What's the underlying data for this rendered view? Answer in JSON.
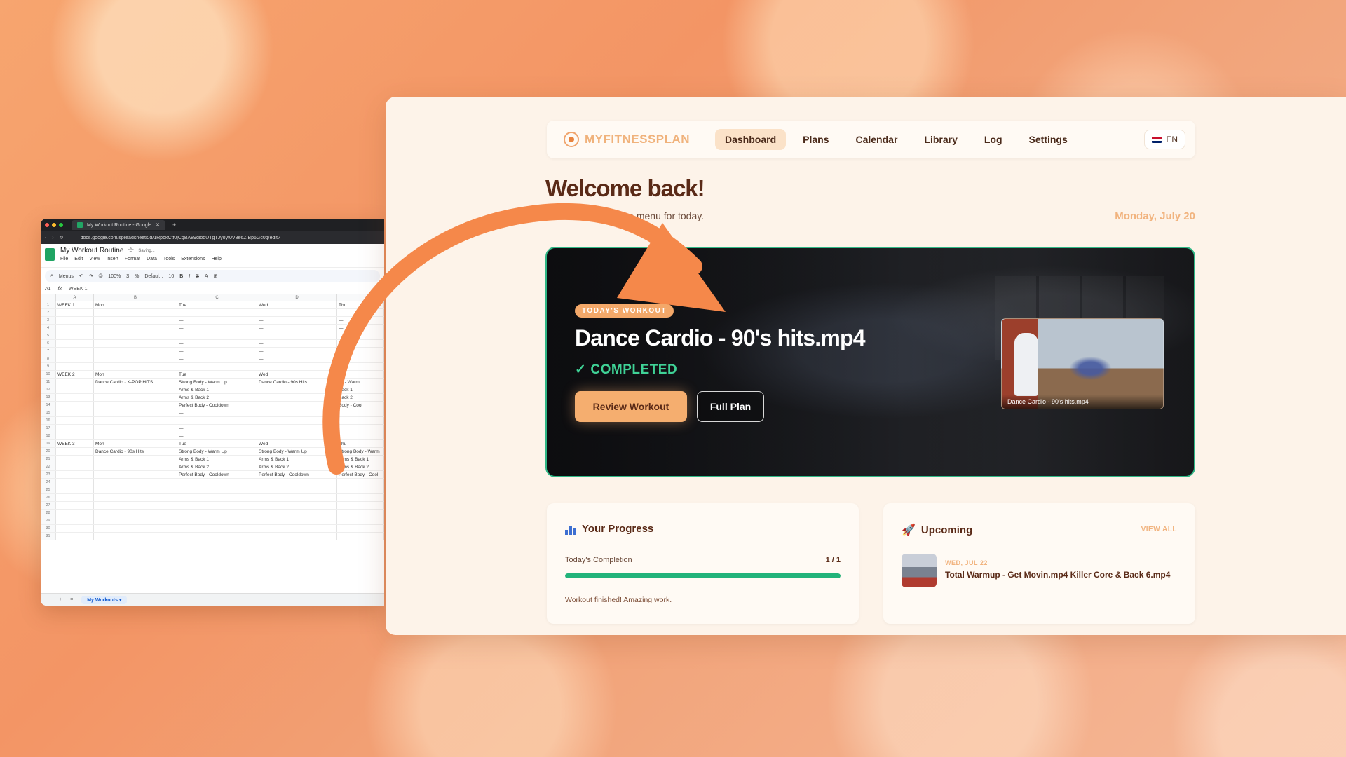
{
  "colors": {
    "accent": "#f5ae6f",
    "completed": "#3fd296",
    "progress_fill": "#22b37a",
    "hero_border": "#2fb685",
    "arrow": "#f5884a"
  },
  "sheet": {
    "browser_tab": "My Workout Routine - Google",
    "url": "docs.google.com/spreadsheets/d/1RpbkCtf0jCgBA89dlodUTgTJyoyt0V8e6ZIBp6Gc0g/edit?",
    "title": "My Workout Routine",
    "saving": "Saving...",
    "menu": [
      "File",
      "Edit",
      "View",
      "Insert",
      "Format",
      "Data",
      "Tools",
      "Extensions",
      "Help"
    ],
    "toolbar": {
      "menus": "Menus",
      "zoom": "100%",
      "currency": "$",
      "percent": "%",
      "font": "Defaul...",
      "font_size": "10"
    },
    "cell_ref": "A1",
    "formula": "WEEK 1",
    "columns": [
      "A",
      "B",
      "C",
      "D",
      ""
    ],
    "rows": [
      [
        "1",
        "WEEK 1",
        "Mon",
        "Tue",
        "Wed",
        "Thu"
      ],
      [
        "2",
        "",
        "—",
        "—",
        "—",
        "—"
      ],
      [
        "3",
        "",
        "",
        "—",
        "—",
        "—"
      ],
      [
        "4",
        "",
        "",
        "—",
        "—",
        "—"
      ],
      [
        "5",
        "",
        "",
        "—",
        "—",
        "—"
      ],
      [
        "6",
        "",
        "",
        "—",
        "—",
        "—"
      ],
      [
        "7",
        "",
        "",
        "—",
        "—",
        ""
      ],
      [
        "8",
        "",
        "",
        "—",
        "—",
        ""
      ],
      [
        "9",
        "",
        "",
        "—",
        "—",
        ""
      ],
      [
        "10",
        "WEEK 2",
        "Mon",
        "Tue",
        "Wed",
        ""
      ],
      [
        "11",
        "",
        "Dance Cardio - K-POP HITS",
        "Strong Body - Warm Up",
        "Dance Cardio - 90s Hits",
        "dy - Warm"
      ],
      [
        "12",
        "",
        "",
        "Arms & Back 1",
        "",
        "Back 1"
      ],
      [
        "13",
        "",
        "",
        "Arms & Back 2",
        "",
        "Back 2"
      ],
      [
        "14",
        "",
        "",
        "Perfect Body - Cooldown",
        "",
        "Body - Cool"
      ],
      [
        "15",
        "",
        "",
        "—",
        "",
        ""
      ],
      [
        "16",
        "",
        "",
        "—",
        "",
        ""
      ],
      [
        "17",
        "",
        "",
        "—",
        "",
        ""
      ],
      [
        "18",
        "",
        "",
        "—",
        "",
        ""
      ],
      [
        "19",
        "WEEK 3",
        "Mon",
        "Tue",
        "Wed",
        "Thu"
      ],
      [
        "20",
        "",
        "Dance Cardio - 90s Hits",
        "Strong Body - Warm Up",
        "Strong Body - Warm Up",
        "Strong Body - Warm"
      ],
      [
        "21",
        "",
        "",
        "Arms & Back 1",
        "Arms & Back 1",
        "Arms & Back 1"
      ],
      [
        "22",
        "",
        "",
        "Arms & Back 2",
        "Arms & Back 2",
        "Arms & Back 2"
      ],
      [
        "23",
        "",
        "",
        "Perfect Body - Cooldown",
        "Perfect Body - Cooldown",
        "Perfect Body - Cool"
      ],
      [
        "24",
        "",
        "",
        "",
        "",
        ""
      ],
      [
        "25",
        "",
        "",
        "",
        "",
        ""
      ],
      [
        "26",
        "",
        "",
        "",
        "",
        ""
      ],
      [
        "27",
        "",
        "",
        "",
        "",
        ""
      ],
      [
        "28",
        "",
        "",
        "",
        "",
        ""
      ],
      [
        "29",
        "",
        "",
        "",
        "",
        ""
      ],
      [
        "30",
        "",
        "",
        "",
        "",
        ""
      ],
      [
        "31",
        "",
        "",
        "",
        "",
        ""
      ]
    ],
    "sheet_tab": "My Workouts"
  },
  "app": {
    "brand": "MYFITNESSPLAN",
    "nav": [
      "Dashboard",
      "Plans",
      "Calendar",
      "Library",
      "Log",
      "Settings"
    ],
    "nav_active": "Dashboard",
    "lang": "EN",
    "welcome": "Welcome back!",
    "subtitle": "Here's what's on the menu for today.",
    "date": "Monday, July 20",
    "hero": {
      "badge": "TODAY'S WORKOUT",
      "title": "Dance Cardio - 90's hits.mp4",
      "status": "COMPLETED",
      "primary_button": "Review Workout",
      "secondary_button": "Full Plan",
      "thumb_caption": "Dance Cardio - 90's hits.mp4"
    },
    "progress": {
      "title": "Your Progress",
      "label": "Today's Completion",
      "value": "1 / 1",
      "fraction": 1.0,
      "note": "Workout finished! Amazing work."
    },
    "upcoming": {
      "title": "Upcoming",
      "view_all": "VIEW ALL",
      "date": "WED, JUL 22",
      "item": "Total Warmup - Get Movin.mp4 Killer Core & Back 6.mp4"
    }
  }
}
